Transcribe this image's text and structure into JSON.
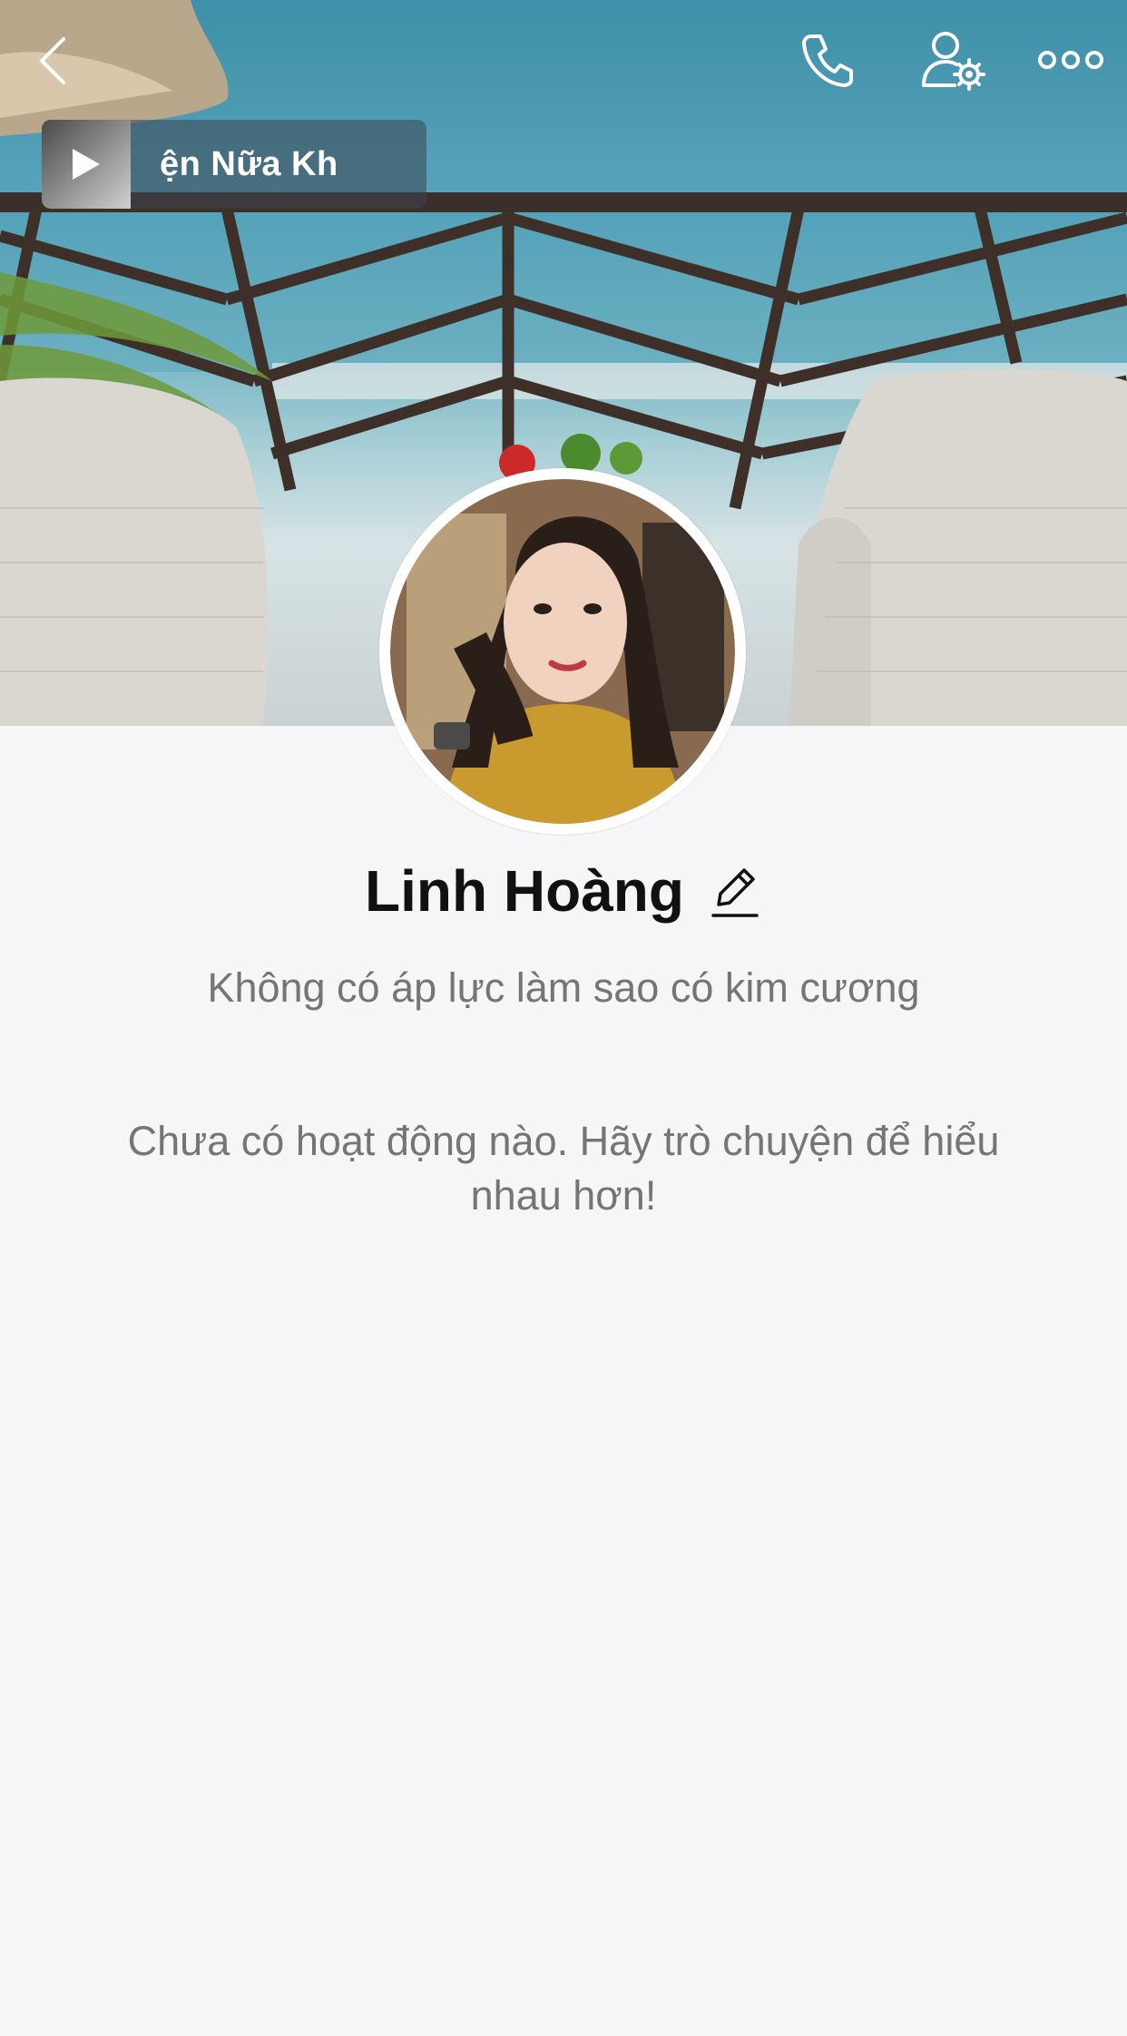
{
  "header": {
    "back_icon": "chevron-left-icon",
    "call_icon": "phone-icon",
    "settings_icon": "user-settings-icon",
    "more_icon": "more-horizontal-icon"
  },
  "music": {
    "title": "ện Nữa       Kh",
    "play_icon": "play-icon"
  },
  "profile": {
    "name": "Linh Hoàng",
    "edit_icon": "pencil-icon",
    "status": "Không có áp lực làm sao có kim cương"
  },
  "feed": {
    "empty_message": "Chưa có hoạt động nào. Hãy trò chuyện để hiểu nhau hơn!"
  },
  "colors": {
    "background": "#f6f6f8",
    "text_primary": "#111111",
    "text_secondary": "#757575"
  }
}
